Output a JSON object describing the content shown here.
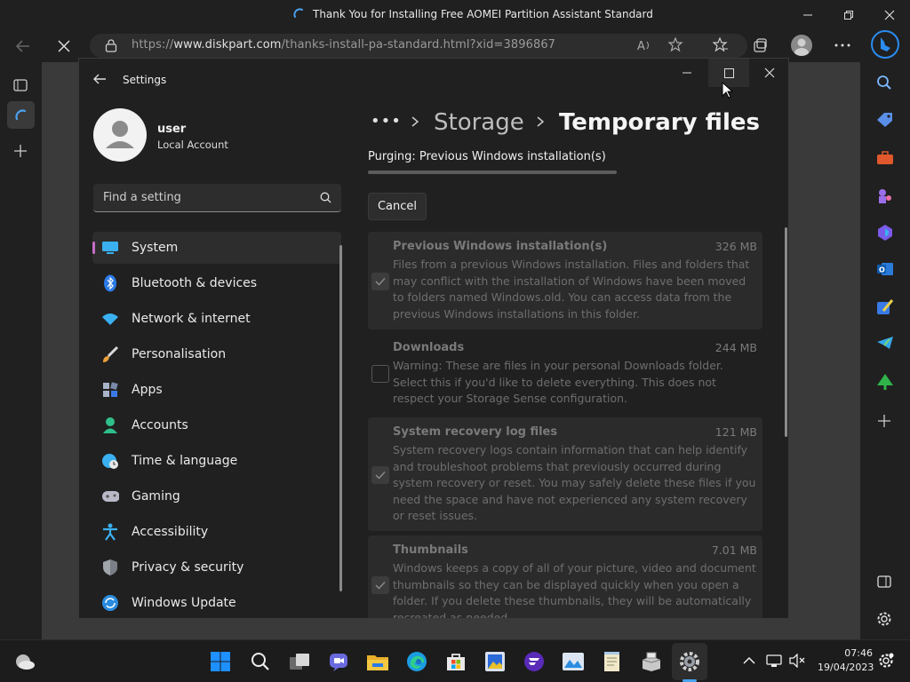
{
  "browser": {
    "tab_title": "Thank You for Installing Free AOMEI Partition Assistant Standard",
    "url_prefix": "https://",
    "url_domain": "www.diskpart.com",
    "url_path": "/thanks-install-pa-standard.html?xid=3896867"
  },
  "settings": {
    "app_title": "Settings",
    "user_name": "user",
    "account_type": "Local Account",
    "search_placeholder": "Find a setting",
    "breadcrumb_more": "•••",
    "breadcrumb_parent": "Storage",
    "breadcrumb_current": "Temporary files",
    "purging_status": "Purging: Previous Windows installation(s)",
    "progress": 1.0,
    "cancel_label": "Cancel",
    "nav_items": [
      {
        "label": "System",
        "icon": "monitor-icon"
      },
      {
        "label": "Bluetooth & devices",
        "icon": "bluetooth-icon"
      },
      {
        "label": "Network & internet",
        "icon": "wifi-icon"
      },
      {
        "label": "Personalisation",
        "icon": "brush-icon"
      },
      {
        "label": "Apps",
        "icon": "apps-icon"
      },
      {
        "label": "Accounts",
        "icon": "person-icon"
      },
      {
        "label": "Time & language",
        "icon": "globe-clock-icon"
      },
      {
        "label": "Gaming",
        "icon": "gamepad-icon"
      },
      {
        "label": "Accessibility",
        "icon": "accessibility-icon"
      },
      {
        "label": "Privacy & security",
        "icon": "shield-icon"
      },
      {
        "label": "Windows Update",
        "icon": "update-icon"
      }
    ],
    "files": [
      {
        "title": "Previous Windows installation(s)",
        "size": "326 MB",
        "checked": true,
        "desc": "Files from a previous Windows installation. Files and folders that may conflict with the installation of Windows have been moved to folders named Windows.old. You can access data from the previous Windows installations in this folder."
      },
      {
        "title": "Downloads",
        "size": "244 MB",
        "checked": false,
        "desc": "Warning: These are files in your personal Downloads folder. Select this if you'd like to delete everything. This does not respect your Storage Sense configuration."
      },
      {
        "title": "System recovery log files",
        "size": "121 MB",
        "checked": true,
        "desc": "System recovery logs contain information that can help identify and troubleshoot problems that previously occurred during system recovery or reset. You may safely delete these files if you need the space and have not experienced any system recovery or reset issues."
      },
      {
        "title": "Thumbnails",
        "size": "7.01 MB",
        "checked": true,
        "desc": "Windows keeps a copy of all of your picture, video and document thumbnails so they can be displayed quickly when you open a folder. If you delete these thumbnails, they will be automatically recreated as needed."
      }
    ]
  },
  "taskbar": {
    "time": "07:46",
    "date": "19/04/2023"
  },
  "colors": {
    "accent": "#c46ec8",
    "windows_blue": "#1e90ff",
    "bing_blue": "#2a8cf0"
  }
}
